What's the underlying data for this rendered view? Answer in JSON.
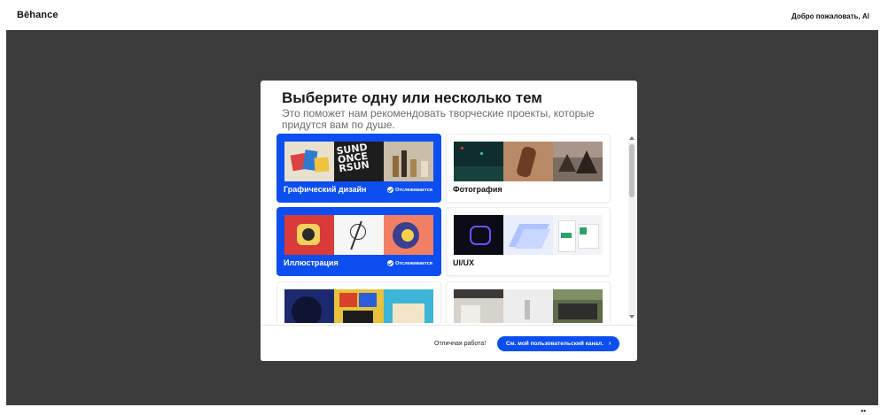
{
  "header": {
    "brand": "Bēhance",
    "welcome": "Добро пожаловать, Al"
  },
  "modal": {
    "title": "Выберите одну или несколько тем",
    "subtitle": "Это поможет нам рекомендовать творческие проекты, которые придутся вам по душе.",
    "topics": [
      {
        "label": "Графический дизайн",
        "selected": true,
        "badge": "Отслеживается"
      },
      {
        "label": "Фотография",
        "selected": false,
        "badge": ""
      },
      {
        "label": "Иллюстрация",
        "selected": true,
        "badge": "Отслеживается"
      },
      {
        "label": "UI/UX",
        "selected": false,
        "badge": ""
      },
      {
        "label": "",
        "selected": false,
        "badge": ""
      },
      {
        "label": "",
        "selected": false,
        "badge": ""
      }
    ],
    "footer": {
      "note": "Отличная работа!",
      "cta": "См. мой пользовательский канал."
    }
  },
  "colors": {
    "accent": "#0d4ef0",
    "backdrop": "#3c3c3c"
  }
}
